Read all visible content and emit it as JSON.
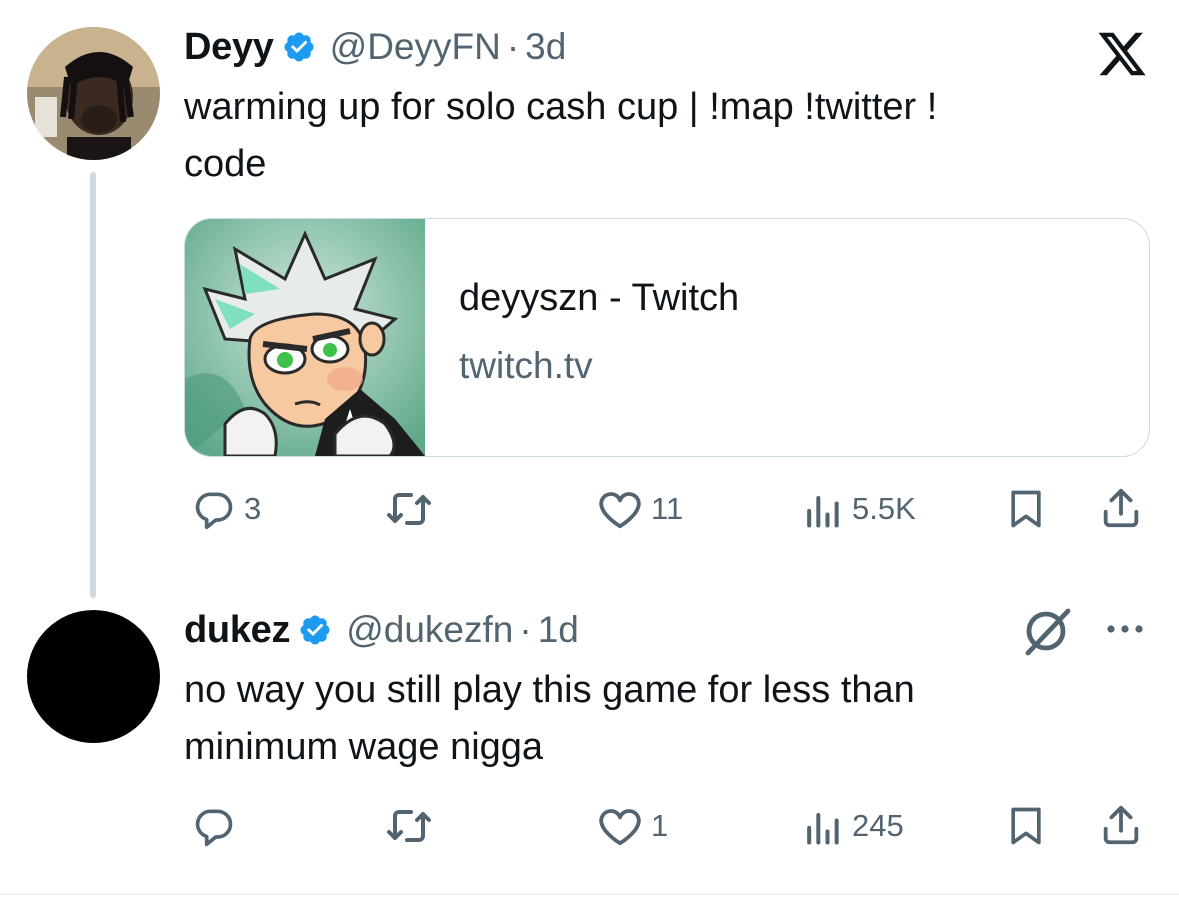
{
  "tweet1": {
    "display_name": "Deyy",
    "handle": "@DeyyFN",
    "separator": "·",
    "time": "3d",
    "text": "warming up for solo cash cup | !map !twitter !\ncode",
    "card": {
      "title": "deyyszn - Twitch",
      "domain": "twitch.tv"
    },
    "actions": {
      "replies": "3",
      "retweets": "",
      "likes": "11",
      "views": "5.5K"
    }
  },
  "tweet2": {
    "display_name": "dukez",
    "handle": "@dukezfn",
    "separator": "·",
    "time": "1d",
    "text": "no way you still play this game for less than\nminimum wage nigga",
    "actions": {
      "replies": "",
      "retweets": "",
      "likes": "1",
      "views": "245"
    }
  },
  "icons": {
    "verified": "verified-badge-icon",
    "x_logo": "x-logo-icon",
    "grok": "grok-icon",
    "more": "more-icon",
    "reply": "reply-icon",
    "retweet": "retweet-icon",
    "like": "like-icon",
    "views": "views-icon",
    "bookmark": "bookmark-icon",
    "share": "share-icon"
  },
  "colors": {
    "verified_blue": "#1d9bf0",
    "secondary_text": "#536471",
    "border": "#cfd9de"
  }
}
